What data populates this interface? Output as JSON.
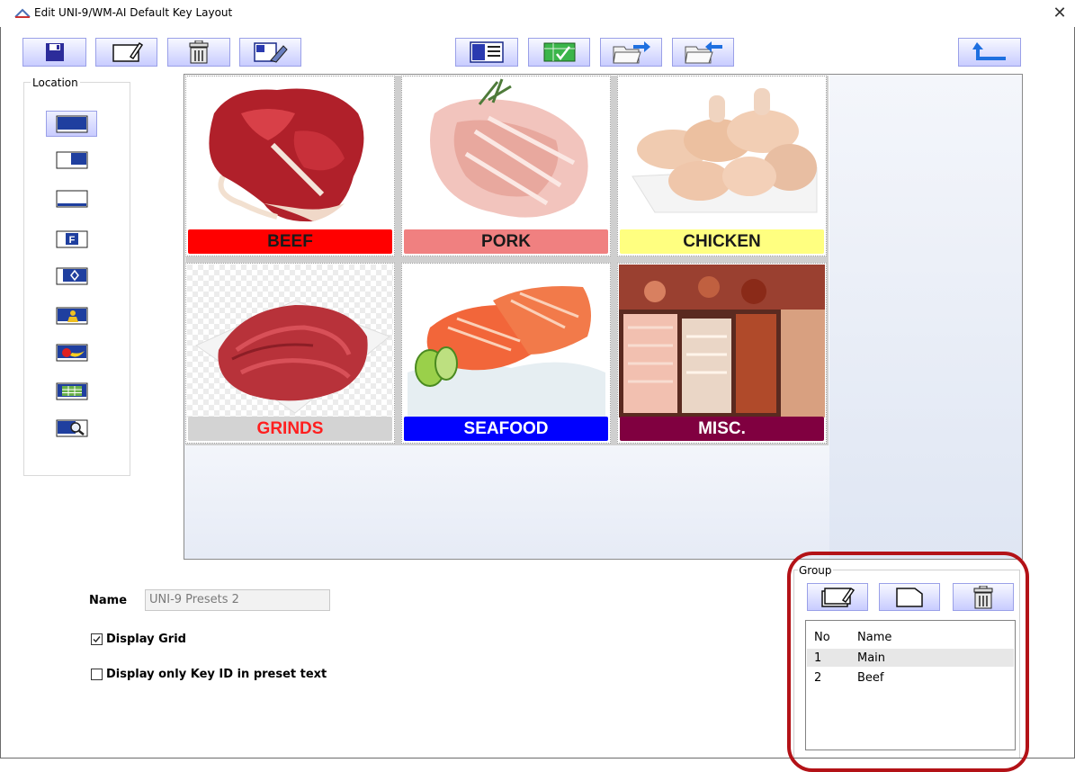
{
  "window": {
    "title": "Edit UNI-9/WM-AI Default Key Layout",
    "close_glyph": "✕"
  },
  "toolbar": {
    "buttons": [
      {
        "name": "save-button",
        "icon": "floppy-disk-icon"
      },
      {
        "name": "edit-button",
        "icon": "edit-pencil-icon"
      },
      {
        "name": "delete-button",
        "icon": "trash-icon"
      },
      {
        "name": "clear-layout-button",
        "icon": "eraser-icon"
      },
      {
        "name": "key-list-button",
        "icon": "list-icon"
      },
      {
        "name": "check-layout-button",
        "icon": "check-icon"
      },
      {
        "name": "export-button",
        "icon": "folder-export-icon"
      },
      {
        "name": "import-button",
        "icon": "folder-import-icon"
      },
      {
        "name": "exit-button",
        "icon": "return-arrow-icon"
      }
    ]
  },
  "location": {
    "label": "Location",
    "items": [
      {
        "name": "location-full",
        "selected": true
      },
      {
        "name": "location-right"
      },
      {
        "name": "location-bottom"
      },
      {
        "name": "location-function-key",
        "glyph": "F"
      },
      {
        "name": "location-diamond",
        "glyph": "◇"
      },
      {
        "name": "location-person"
      },
      {
        "name": "location-produce"
      },
      {
        "name": "location-grid"
      },
      {
        "name": "location-search"
      }
    ]
  },
  "keys": [
    {
      "label": "BEEF",
      "bg": "#ff0000",
      "fg": "#1a1a1a",
      "image": "beef-steak"
    },
    {
      "label": "PORK",
      "bg": "#f08080",
      "fg": "#1a1a1a",
      "image": "pork-roast"
    },
    {
      "label": "CHICKEN",
      "bg": "#ffff80",
      "fg": "#1a1a1a",
      "image": "chicken-legs"
    },
    {
      "label": "GRINDS",
      "bg": "#d3d3d3",
      "fg": "#ff1f1f",
      "image": "ground-meat"
    },
    {
      "label": "SEAFOOD",
      "bg": "#0000ff",
      "fg": "#ffffff",
      "image": "salmon-fillet"
    },
    {
      "label": "MISC.",
      "bg": "#800040",
      "fg": "#ffffff",
      "image": "deli-case"
    }
  ],
  "form": {
    "name_label": "Name",
    "name_value": "UNI-9 Presets 2",
    "display_grid": {
      "label": "Display Grid",
      "checked": true
    },
    "display_key_id": {
      "label": "Display only Key ID in preset text",
      "checked": false
    }
  },
  "group": {
    "label": "Group",
    "columns": {
      "no": "No",
      "name": "Name"
    },
    "rows": [
      {
        "no": "1",
        "name": "Main",
        "selected": true
      },
      {
        "no": "2",
        "name": "Beef",
        "selected": false
      }
    ]
  },
  "colors": {
    "highlight": "#b31217",
    "accent": "#c8ccff"
  }
}
